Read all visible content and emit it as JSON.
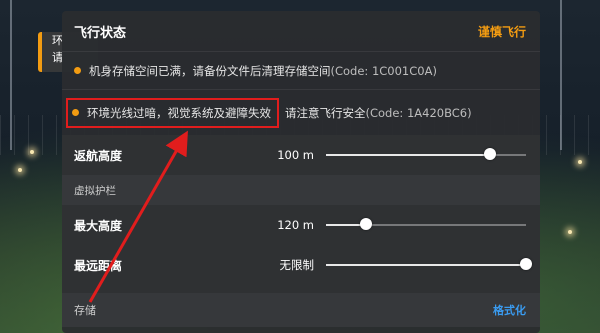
{
  "background": {
    "left_tooltip_lines": [
      "环",
      "请"
    ]
  },
  "panel": {
    "title": "飞行状态",
    "header_action": "谨慎飞行",
    "status_items": [
      {
        "text": "机身存储空间已满，请备份文件后清理存储空间",
        "code": "(Code: 1C001C0A)"
      },
      {
        "text": "环境光线过暗，视觉系统及避障失效",
        "rest": "请注意飞行安全",
        "code": "(Code: 1A420BC6)"
      }
    ],
    "return_altitude": {
      "label": "返航高度",
      "value": "100 m",
      "level": 0.82
    },
    "virtual_fence": {
      "section_label": "虚拟护栏",
      "max_altitude": {
        "label": "最大高度",
        "value": "120 m",
        "level": 0.2
      },
      "max_distance": {
        "label": "最远距离",
        "value": "无限制",
        "level": 1.0
      }
    },
    "storage": {
      "label": "存储",
      "action": "格式化"
    }
  },
  "colors": {
    "warning_orange": "#f39c12",
    "highlight_red": "#e11d1d",
    "link_blue": "#3a9bf0"
  }
}
